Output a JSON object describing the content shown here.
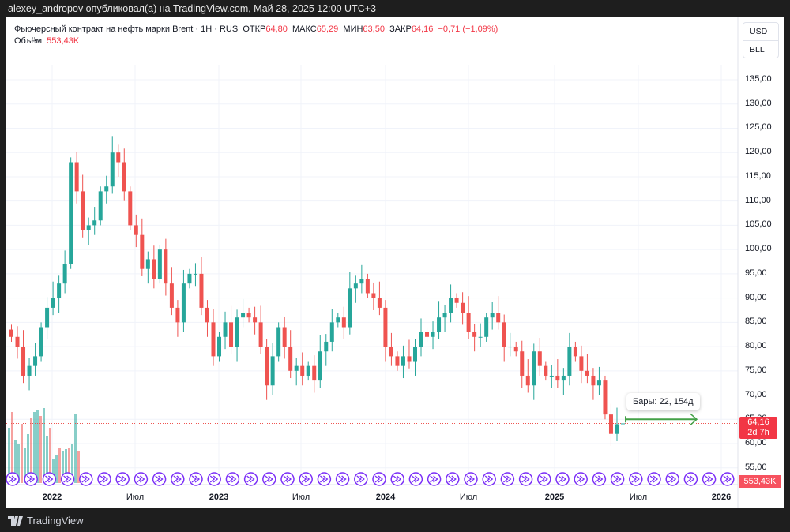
{
  "header": {
    "publisher_line": "alexey_andropov опубликовал(а) на TradingView.com, Май 28, 2025 12:00 UTC+3"
  },
  "legend": {
    "symbol": "Фьючерсный контракт на нефть марки Brent · 1H · RUS",
    "open_label": "ОТКР",
    "open": "64,80",
    "high_label": "МАКС",
    "high": "65,29",
    "low_label": "МИН",
    "low": "63,50",
    "close_label": "ЗАКР",
    "close": "64,16",
    "change": "−0,71 (−1,09%)",
    "volume_label": "Объём",
    "volume": "553,43K"
  },
  "currency": {
    "usd": "USD",
    "unit": "BLL"
  },
  "price_axis": [
    "135,00",
    "130,00",
    "125,00",
    "120,00",
    "115,00",
    "110,00",
    "105,00",
    "100,00",
    "95,00",
    "90,00",
    "85,00",
    "80,00",
    "75,00",
    "70,00",
    "65,00",
    "60,00",
    "55,00"
  ],
  "time_axis": [
    {
      "label": "2022",
      "year": true
    },
    {
      "label": "Июл",
      "year": false
    },
    {
      "label": "2023",
      "year": true
    },
    {
      "label": "Июл",
      "year": false
    },
    {
      "label": "2024",
      "year": true
    },
    {
      "label": "Июл",
      "year": false
    },
    {
      "label": "2025",
      "year": true
    },
    {
      "label": "Июл",
      "year": false
    },
    {
      "label": "2026",
      "year": true
    }
  ],
  "price_tag": {
    "price": "64,16",
    "countdown": "2d 7h"
  },
  "volume_tag": "553,43K",
  "tooltip": "Бары: 22, 154д",
  "footer": {
    "brand": "TradingView"
  },
  "colors": {
    "up": "#26a69a",
    "down": "#ef5350",
    "marker": "#7b2ff7"
  },
  "chart_data": {
    "type": "candlestick",
    "ylim": [
      52,
      140
    ],
    "closes": [
      82,
      80,
      74,
      76,
      78,
      84,
      88,
      90,
      93,
      97,
      118,
      112,
      104,
      105,
      106,
      112,
      113,
      120,
      118,
      112,
      105,
      103,
      96,
      98,
      94,
      100,
      93,
      88,
      85,
      93,
      95,
      95,
      88,
      85,
      78,
      82,
      85,
      80,
      86,
      87,
      86,
      85,
      80,
      72,
      78,
      84,
      80,
      75,
      76,
      74,
      76,
      73,
      79,
      81,
      85,
      86,
      84,
      92,
      93,
      94,
      91,
      90,
      88,
      80,
      78,
      76,
      78,
      77,
      80,
      83,
      82,
      83,
      86,
      87,
      90,
      89,
      87,
      83,
      82,
      82,
      86,
      87,
      85,
      80,
      80,
      79,
      74,
      72,
      79,
      76,
      74,
      74,
      73,
      74,
      80,
      78,
      75,
      74,
      72,
      73,
      66,
      62,
      64,
      64.16
    ],
    "volume_relative": [
      0.7,
      0.9,
      0.55,
      0.5,
      0.75,
      0.45,
      0.62,
      0.82,
      0.9,
      0.92,
      0.85,
      0.95,
      0.6,
      0.7,
      0.3,
      0.35,
      0.45,
      0.4,
      0.43,
      0.44,
      0.5,
      0.88,
      0.4
    ]
  }
}
